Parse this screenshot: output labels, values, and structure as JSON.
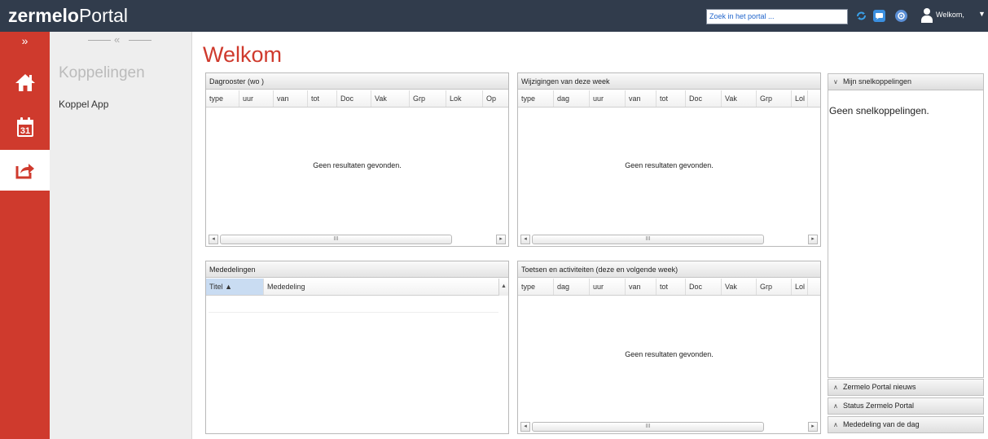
{
  "app": {
    "logo_bold": "zermelo",
    "logo_light": "Portal",
    "search_placeholder": "Zoek in het portal ...",
    "welcome_user": "Welkom,"
  },
  "colors": {
    "brand_red": "#cf3a2d",
    "topbar": "#313c4c"
  },
  "iconbar": {
    "expand_label": "»",
    "items": [
      {
        "icon": "home-icon"
      },
      {
        "icon": "calendar-icon",
        "label": "31"
      },
      {
        "icon": "share-icon",
        "active": true
      }
    ]
  },
  "subnav": {
    "collapse_label": "«",
    "title": "Koppelingen",
    "items": [
      {
        "label": "Koppel App"
      }
    ]
  },
  "page": {
    "title": "Welkom"
  },
  "panels": {
    "dagrooster": {
      "title": "Dagrooster (wo      )",
      "columns": [
        "type",
        "uur",
        "van",
        "tot",
        "Doc",
        "Vak",
        "Grp",
        "Lok",
        "Op"
      ],
      "empty": "Geen resultaten gevonden.",
      "scroll_mark": "III"
    },
    "wijzigingen": {
      "title": "Wijzigingen van deze week",
      "columns": [
        "type",
        "dag",
        "uur",
        "van",
        "tot",
        "Doc",
        "Vak",
        "Grp",
        "Lol"
      ],
      "empty": "Geen resultaten gevonden.",
      "scroll_mark": "III"
    },
    "mededelingen": {
      "title": "Mededelingen",
      "columns": [
        "Titel ▲",
        "Mededeling"
      ]
    },
    "toetsen": {
      "title": "Toetsen en activiteiten (deze en volgende week)",
      "columns": [
        "type",
        "dag",
        "uur",
        "van",
        "tot",
        "Doc",
        "Vak",
        "Grp",
        "Lol"
      ],
      "empty": "Geen resultaten gevonden.",
      "scroll_mark": "III"
    }
  },
  "accordion": {
    "snelkoppelingen": {
      "title": "Mijn snelkoppelingen",
      "body": "Geen snelkoppelingen."
    },
    "sections": [
      {
        "title": "Zermelo Portal nieuws"
      },
      {
        "title": "Status Zermelo Portal"
      },
      {
        "title": "Mededeling van de dag"
      }
    ]
  }
}
